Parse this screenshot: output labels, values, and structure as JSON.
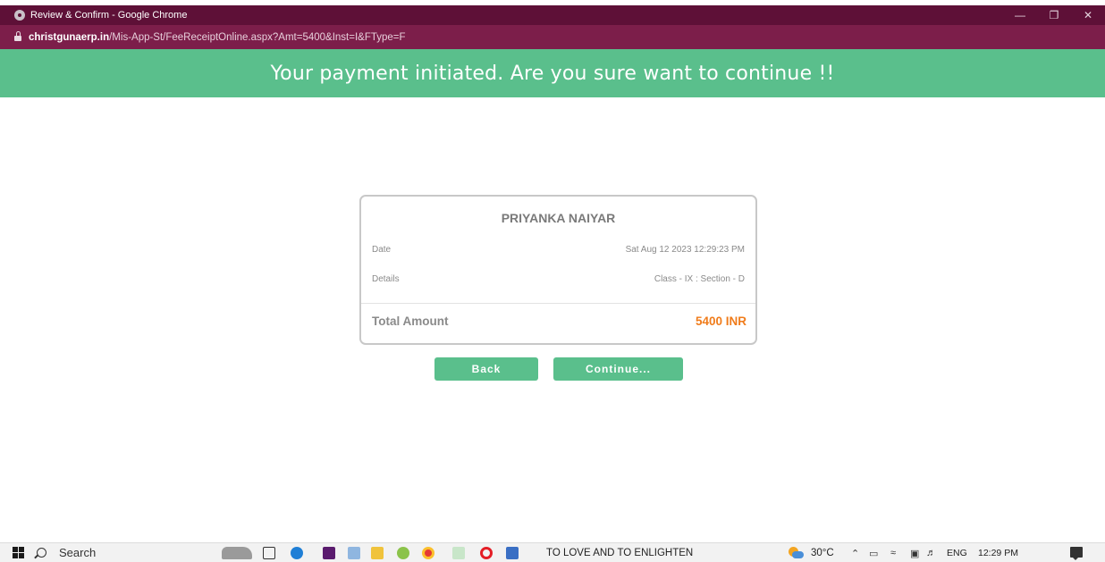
{
  "browser": {
    "window_title": "Review & Confirm - Google Chrome",
    "url_domain": "christgunaerp.in",
    "url_path": "/Mis-App-St/FeeReceiptOnline.aspx?Amt=5400&Inst=I&FType=F"
  },
  "banner": {
    "message": "Your payment initiated. Are you sure want to continue !!"
  },
  "receipt": {
    "student_name": "PRIYANKA NAIYAR",
    "date_label": "Date",
    "date_value": "Sat Aug 12 2023 12:29:23 PM",
    "details_label": "Details",
    "details_value": "Class - IX : Section - D",
    "total_label": "Total Amount",
    "total_value": "5400 INR"
  },
  "actions": {
    "back_label": "Back",
    "continue_label": "Continue..."
  },
  "taskbar": {
    "search_label": "Search",
    "slogan": "TO LOVE AND TO ENLIGHTEN",
    "temperature": "30°C",
    "language": "ENG",
    "time": "12:29 PM"
  },
  "colors": {
    "title_bar": "#5e1037",
    "address_bar": "#7c1e4a",
    "accent_green": "#5abf8c",
    "amount_orange": "#f07c1b"
  }
}
